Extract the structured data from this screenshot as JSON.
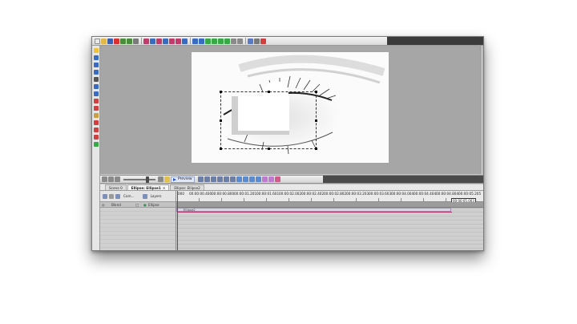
{
  "timeline": {
    "tabs": [
      "Scene 0",
      "Ellipse: Ellipse1",
      "Ellipse: Ellipse2"
    ],
    "tab_close": "×",
    "left_toolbar_labels": [
      "Com...",
      "Layers"
    ],
    "column_headers": [
      "Blend",
      "Ellipse"
    ],
    "ruler_labels": [
      "00:00:00.400",
      "00:00:00.800",
      "00:00:01.201",
      "00:00:01.601",
      "00:00:02.002",
      "00:00:02.402",
      "00:00:02.802",
      "00:00:03.203",
      "00:00:03.603",
      "00:00:04.004",
      "00:00:04.404",
      "00:00:04.804",
      "00:00:05.205"
    ],
    "ruler_start": "000",
    "end_timecode": "00:00:05.003",
    "clip_label": "Ellipse2"
  },
  "transport": {
    "preview_label": "Preview"
  },
  "colors": {
    "stage_bg": "#a6a6a6",
    "playhead": "#d81d1d",
    "clip_accent": "#b0306a"
  },
  "icons": {
    "toolbar": [
      "new-icon",
      "open-icon",
      "save-icon",
      "close-red-icon",
      "undo-icon",
      "redo-icon",
      "copy-icon",
      "paste-icon",
      "align-icon",
      "shape-icon",
      "text-icon",
      "move-up-icon",
      "move-down-icon",
      "group-icon",
      "lock-icon",
      "help-icon"
    ],
    "left_tools": [
      "select-icon",
      "zoom-icon",
      "pen-icon",
      "shape-icon",
      "text-icon",
      "rect-icon",
      "ellipse-icon",
      "paint-icon",
      "eyedropper-icon",
      "fill-icon",
      "hand-icon"
    ]
  }
}
